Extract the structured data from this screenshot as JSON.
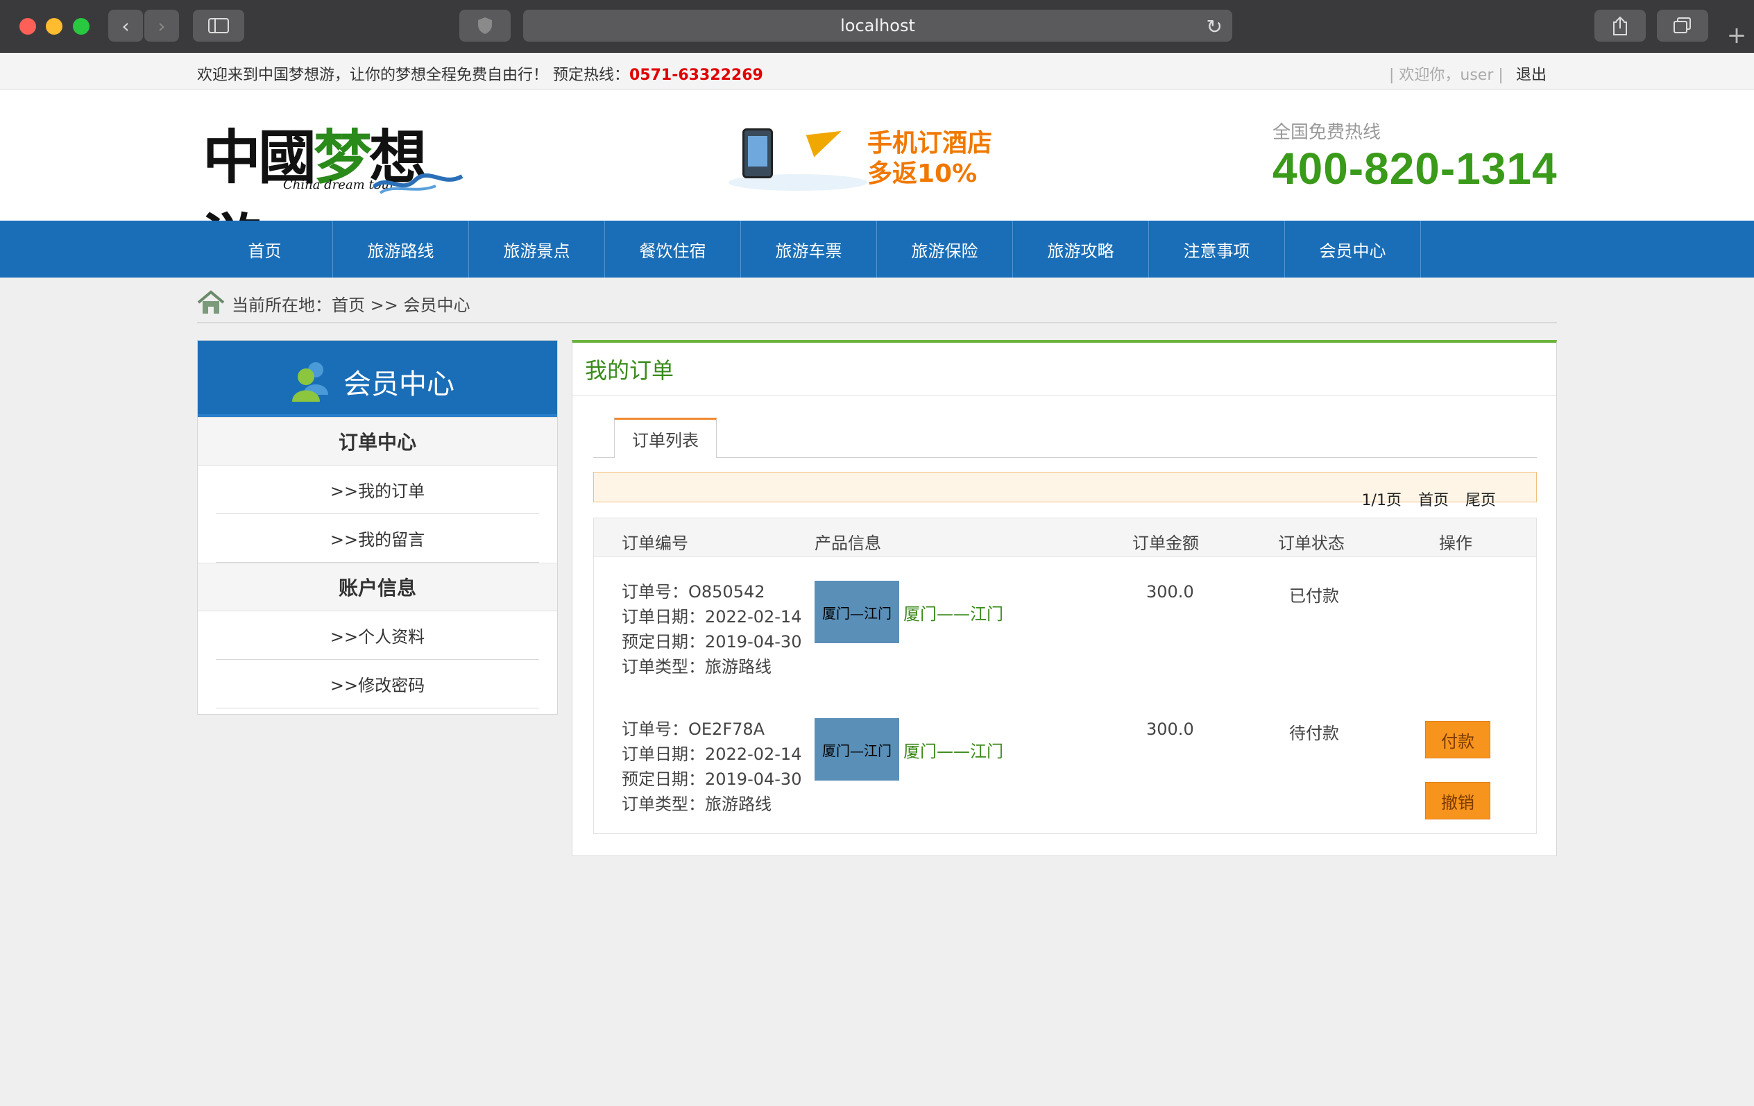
{
  "browser": {
    "url": "localhost"
  },
  "topbar": {
    "welcome": "欢迎来到中国梦想游，让你的梦想全程免费自由行！ 预定热线：",
    "hotline": "0571-63322269",
    "user_greeting": "| 欢迎你，user |",
    "logout": "退出"
  },
  "header": {
    "logo_cn_1": "中國",
    "logo_cn_2": "梦",
    "logo_cn_3": "想游",
    "logo_en": "China dream tour",
    "promo_line1": "手机订酒店",
    "promo_line2": "多返10%",
    "freeline_label": "全国免费热线",
    "freeline_number": "400-820-1314"
  },
  "nav": [
    "首页",
    "旅游路线",
    "旅游景点",
    "餐饮住宿",
    "旅游车票",
    "旅游保险",
    "旅游攻略",
    "注意事项",
    "会员中心"
  ],
  "breadcrumb": "当前所在地：首页 >> 会员中心",
  "sidebar": {
    "title": "会员中心",
    "section1": "订单中心",
    "item1": ">>我的订单",
    "item2": ">>我的留言",
    "section2": "账户信息",
    "item3": ">>个人资料",
    "item4": ">>修改密码"
  },
  "main": {
    "title": "我的订单",
    "tab": "订单列表",
    "pager": {
      "page": "1/1页",
      "first": "首页",
      "last": "尾页"
    },
    "columns": [
      "订单编号",
      "产品信息",
      "订单金额",
      "订单状态",
      "操作"
    ],
    "orders": [
      {
        "no": "订单号：O850542",
        "date": "订单日期：2022-02-14",
        "book": "预定日期：2019-04-30",
        "type": "订单类型：旅游路线",
        "thumb": "厦门—江门",
        "product": "厦门——江门",
        "amount": "300.0",
        "status": "已付款"
      },
      {
        "no": "订单号：OE2F78A",
        "date": "订单日期：2022-02-14",
        "book": "预定日期：2019-04-30",
        "type": "订单类型：旅游路线",
        "thumb": "厦门—江门",
        "product": "厦门——江门",
        "amount": "300.0",
        "status": "待付款",
        "pay": "付款",
        "cancel": "撤销"
      }
    ]
  },
  "colors": {
    "nav_blue": "#1a6eb7",
    "green": "#3a8a1a",
    "hotline_red": "#e00000",
    "orange": "#f7941d"
  }
}
